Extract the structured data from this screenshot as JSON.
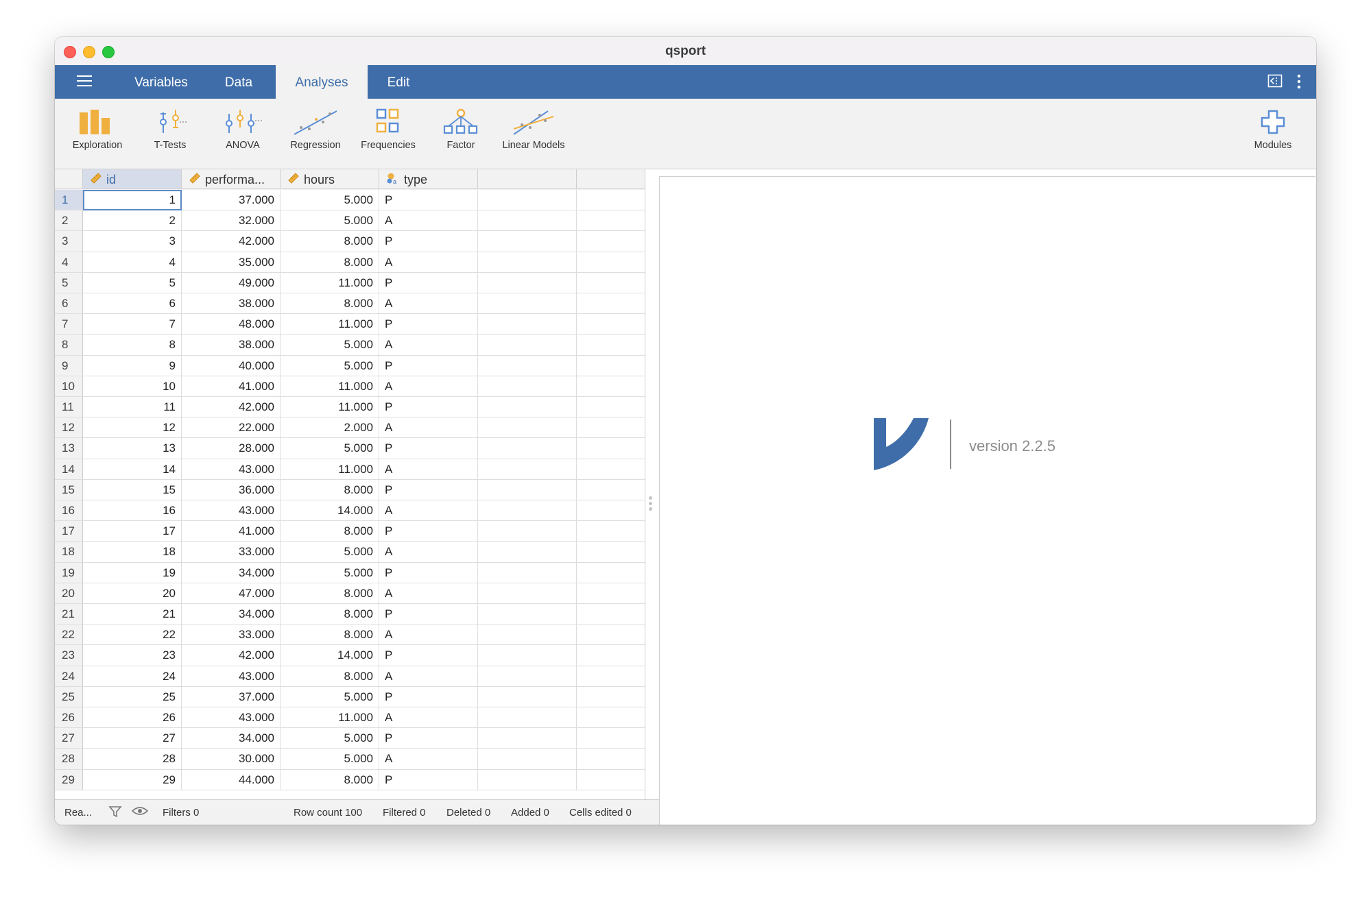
{
  "window": {
    "title": "qsport"
  },
  "tabs": [
    "Variables",
    "Data",
    "Analyses",
    "Edit"
  ],
  "active_tab": "Analyses",
  "toolbar": {
    "tools": [
      "Exploration",
      "T-Tests",
      "ANOVA",
      "Regression",
      "Frequencies",
      "Factor",
      "Linear Models"
    ],
    "modules_label": "Modules"
  },
  "columns": [
    "id",
    "performa...",
    "hours",
    "type"
  ],
  "rows": [
    [
      "1",
      "1",
      "37.000",
      "5.000",
      "P"
    ],
    [
      "2",
      "2",
      "32.000",
      "5.000",
      "A"
    ],
    [
      "3",
      "3",
      "42.000",
      "8.000",
      "P"
    ],
    [
      "4",
      "4",
      "35.000",
      "8.000",
      "A"
    ],
    [
      "5",
      "5",
      "49.000",
      "11.000",
      "P"
    ],
    [
      "6",
      "6",
      "38.000",
      "8.000",
      "A"
    ],
    [
      "7",
      "7",
      "48.000",
      "11.000",
      "P"
    ],
    [
      "8",
      "8",
      "38.000",
      "5.000",
      "A"
    ],
    [
      "9",
      "9",
      "40.000",
      "5.000",
      "P"
    ],
    [
      "10",
      "10",
      "41.000",
      "11.000",
      "A"
    ],
    [
      "11",
      "11",
      "42.000",
      "11.000",
      "P"
    ],
    [
      "12",
      "12",
      "22.000",
      "2.000",
      "A"
    ],
    [
      "13",
      "13",
      "28.000",
      "5.000",
      "P"
    ],
    [
      "14",
      "14",
      "43.000",
      "11.000",
      "A"
    ],
    [
      "15",
      "15",
      "36.000",
      "8.000",
      "P"
    ],
    [
      "16",
      "16",
      "43.000",
      "14.000",
      "A"
    ],
    [
      "17",
      "17",
      "41.000",
      "8.000",
      "P"
    ],
    [
      "18",
      "18",
      "33.000",
      "5.000",
      "A"
    ],
    [
      "19",
      "19",
      "34.000",
      "5.000",
      "P"
    ],
    [
      "20",
      "20",
      "47.000",
      "8.000",
      "A"
    ],
    [
      "21",
      "21",
      "34.000",
      "8.000",
      "P"
    ],
    [
      "22",
      "22",
      "33.000",
      "8.000",
      "A"
    ],
    [
      "23",
      "23",
      "42.000",
      "14.000",
      "P"
    ],
    [
      "24",
      "24",
      "43.000",
      "8.000",
      "A"
    ],
    [
      "25",
      "25",
      "37.000",
      "5.000",
      "P"
    ],
    [
      "26",
      "26",
      "43.000",
      "11.000",
      "A"
    ],
    [
      "27",
      "27",
      "34.000",
      "5.000",
      "P"
    ],
    [
      "28",
      "28",
      "30.000",
      "5.000",
      "A"
    ],
    [
      "29",
      "29",
      "44.000",
      "8.000",
      "P"
    ]
  ],
  "status": {
    "ready": "Rea...",
    "filters": "Filters 0",
    "row_count": "Row count 100",
    "filtered": "Filtered 0",
    "deleted": "Deleted 0",
    "added": "Added 0",
    "cells_edited": "Cells edited 0"
  },
  "results": {
    "version": "version 2.2.5"
  },
  "colors": {
    "brand": "#3e6da9",
    "accent_orange": "#f0b040",
    "icon_blue": "#5b8ed6"
  }
}
